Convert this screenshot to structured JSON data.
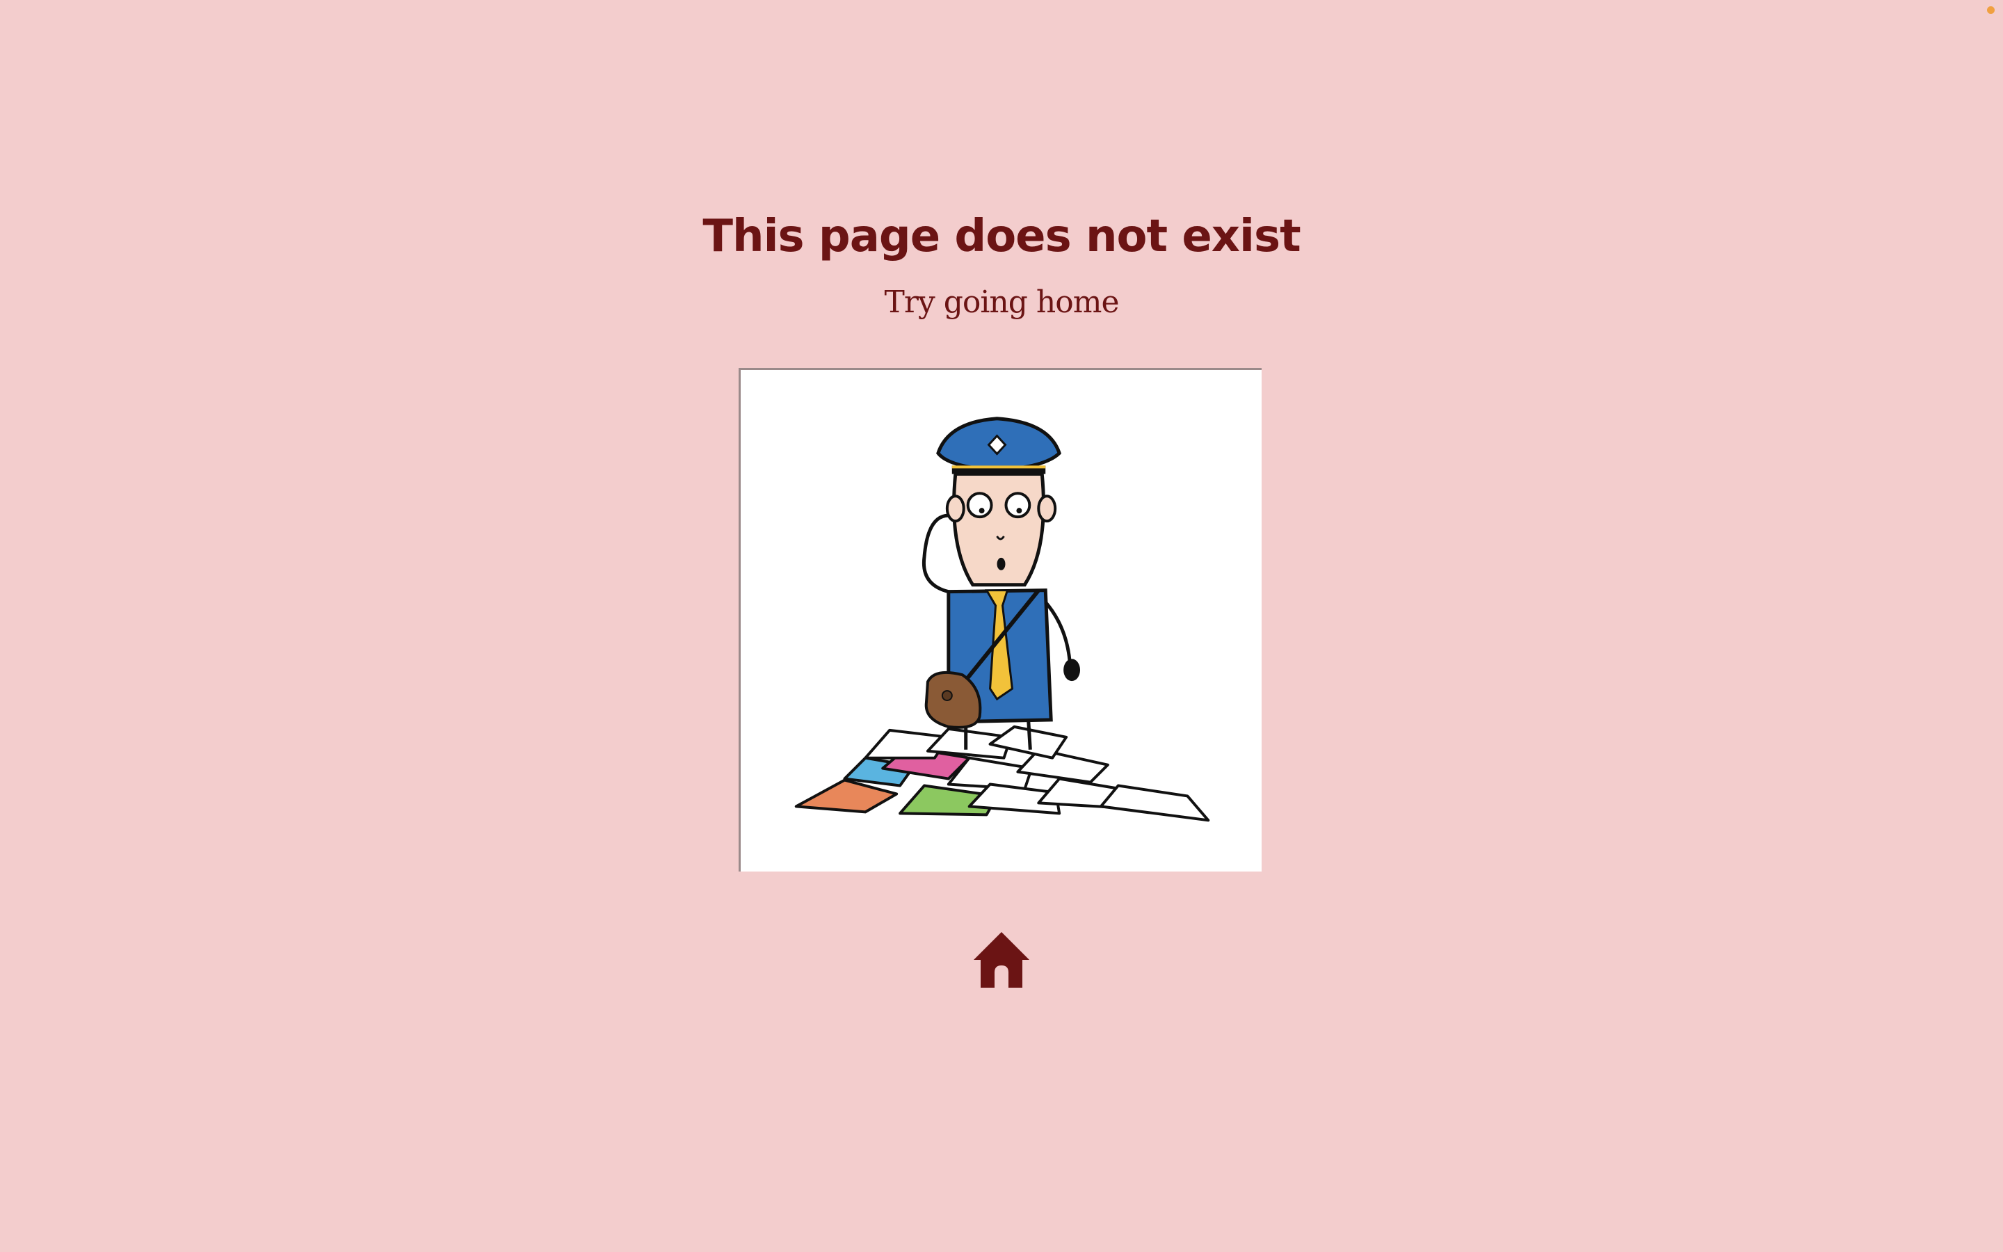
{
  "page": {
    "title": "This page does not exist",
    "subtitle": "Try going home",
    "illustration_icon": "confused-mail-carrier-illustration",
    "home_icon": "home-icon",
    "colors": {
      "background": "#f3cdcd",
      "text": "#6b1414",
      "corner_dot": "#f0a040"
    }
  }
}
